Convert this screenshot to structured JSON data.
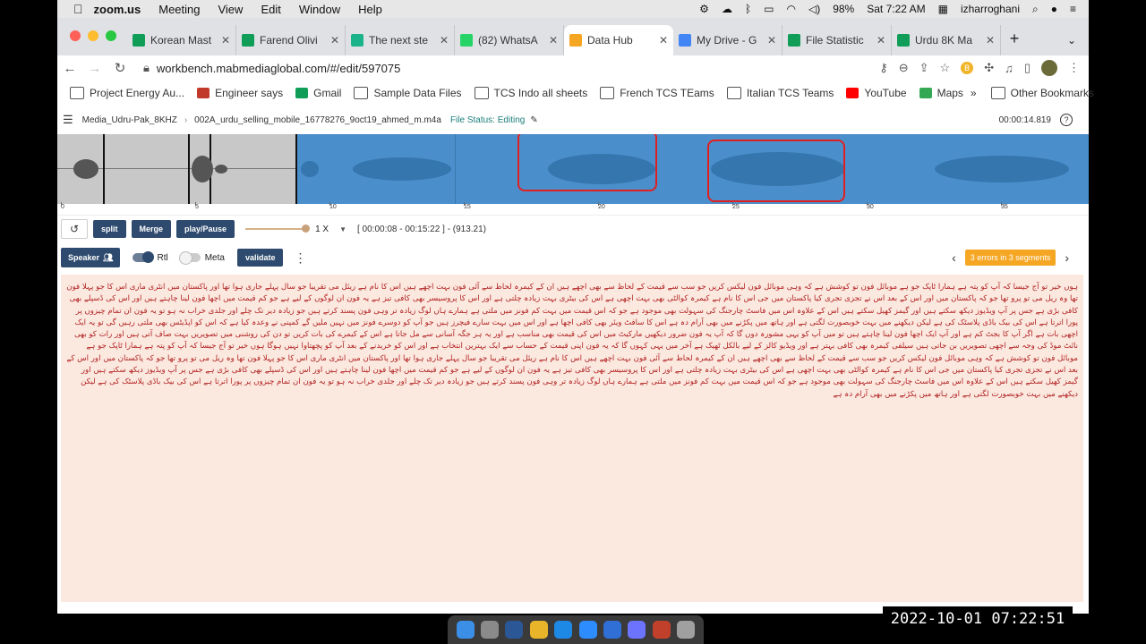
{
  "mac_menubar": {
    "app": "zoom.us",
    "menus": [
      "Meeting",
      "View",
      "Edit",
      "Window",
      "Help"
    ],
    "battery": "98%",
    "clock": "Sat 7:22 AM",
    "user": "izharroghani",
    "icons": [
      "gear-icon",
      "cloud-icon",
      "bluetooth-icon",
      "battery-icon",
      "wifi-icon",
      "volume-icon",
      "search-icon"
    ]
  },
  "tabs": [
    {
      "title": "Korean Mast",
      "color": "#0f9d58"
    },
    {
      "title": "Farend Olivi",
      "color": "#0f9d58"
    },
    {
      "title": "The next ste",
      "color": "#1bb38a"
    },
    {
      "title": "(82) WhatsA",
      "color": "#25d366"
    },
    {
      "title": "Data Hub",
      "color": "#f5a623",
      "active": true
    },
    {
      "title": "My Drive - G",
      "color": "#4285f4"
    },
    {
      "title": "File Statistic",
      "color": "#0f9d58"
    },
    {
      "title": "Urdu 8K Ma",
      "color": "#0f9d58"
    }
  ],
  "address": {
    "url": "workbench.mabmediaglobal.com/#/edit/597075"
  },
  "bookmarks": [
    {
      "label": "Project Energy Au...",
      "kind": "folder"
    },
    {
      "label": "Engineer says",
      "kind": "flag",
      "color": "#c0392b"
    },
    {
      "label": "Gmail",
      "kind": "icon",
      "color": "#0f9d58"
    },
    {
      "label": "Sample Data Files",
      "kind": "folder"
    },
    {
      "label": "TCS Indo all sheets",
      "kind": "folder"
    },
    {
      "label": "French TCS TEams",
      "kind": "folder"
    },
    {
      "label": "Italian TCS Teams",
      "kind": "folder"
    },
    {
      "label": "YouTube",
      "kind": "icon",
      "color": "#ff0000"
    },
    {
      "label": "Maps",
      "kind": "icon",
      "color": "#34a853"
    }
  ],
  "bookmarks_more": "»",
  "other_bookmarks": "Other Bookmarks",
  "breadcrumb": {
    "project": "Media_Udru-Pak_8KHZ",
    "file": "002A_urdu_selling_mobile_16778276_9oct19_ahmed_m.m4a",
    "status": "File Status: Editing",
    "time": "00:00:14.819"
  },
  "ruler": {
    "ticks": [
      "0",
      "5",
      "10",
      "15",
      "20",
      "25",
      "30",
      "35"
    ]
  },
  "controls": {
    "split": "split",
    "merge": "Merge",
    "play": "play/Pause",
    "speed": "1 X",
    "range": "[ 00:00:08 - 00:15:22 ] - (913.21)"
  },
  "toolbar2": {
    "speaker": "Speaker",
    "rtl": "Rtl",
    "meta": "Meta",
    "validate": "validate",
    "errors": "3 errors in 3 segments"
  },
  "transcript": "ہوں خیر تو آج جیسا کہ آپ کو پتہ ہے ہمارا ٹاپک جو ہے موبائل فون تو کوشش ہے کہ وہی موبائل فون لیکس کریں جو سب سے قیمت کے لحاظ سے بھی اچھے ہیں ان کے کیمرہ لحاظ سے آئی فون بہت اچھے ہیں اس کا نام ہے ریئل می تقریبا جو سال پہلے جاری ہوا تھا اور پاکستان میں انٹری ماری اس کا جو پہلا فون تھا وہ ریل می تو پرو تھا جو کہ پاکستان میں اور اس کے بعد اس نے تجزی تجری کیا پاکستان میں جی اس کا نام ہے کیمرہ کوالٹی بھی بہت اچھی ہے اس کی بیٹری بہت زیادہ چلتی ہے اور اس کا پروسیسر بھی کافی تیز ہے یہ فون ان لوگوں کے لیے ہے جو کم قیمت میں اچھا فون لینا چاہتے ہیں اور اس کی ڈسپلے بھی کافی بڑی ہے جس پر آپ ویڈیوز دیکھ سکتے ہیں اور گیمز کھیل سکتے ہیں اس کے علاوہ اس میں فاسٹ چارجنگ کی سہولت بھی موجود ہے جو کہ اس قیمت میں بہت کم فونز میں ملتی ہے ہمارے ہاں لوگ زیادہ تر وہی فون پسند کرتے ہیں جو زیادہ دیر تک چلے اور جلدی خراب نہ ہو تو یہ فون ان تمام چیزوں پر پورا اترتا ہے اس کی بیک باڈی پلاسٹک کی ہے لیکن دیکھنے میں بہت خوبصورت لگتی ہے اور ہاتھ میں پکڑنے میں بھی آرام دہ ہے اس کا سافٹ ویئر بھی کافی اچھا ہے اور اس میں بہت سارے فیچرز ہیں جو آپ کو دوسرے فونز میں نہیں ملیں گے کمپنی نے وعدہ کیا ہے کہ اس کو اپڈیٹس بھی ملتی رہیں گی تو یہ ایک اچھی بات ہے اگر آپ کا بجٹ کم ہے اور آپ ایک اچھا فون لینا چاہتے ہیں تو میں آپ کو یہی مشورہ دوں گا کہ آپ یہ فون ضرور دیکھیں مارکیٹ میں اس کی قیمت بھی مناسب ہے اور یہ ہر جگہ آسانی سے مل جاتا ہے اس کے کیمرے کی بات کریں تو دن کی روشنی میں تصویریں بہت صاف آتی ہیں اور رات کو بھی نائٹ موڈ کی وجہ سے اچھی تصویریں بن جاتی ہیں سیلفی کیمرہ بھی کافی بہتر ہے اور ویڈیو کالز کے لیے بالکل ٹھیک ہے آخر میں یہی کہوں گا کہ یہ فون اپنی قیمت کے حساب سے ایک بہترین انتخاب ہے اور اس کو خریدنے کے بعد آپ کو پچھتاوا نہیں ہوگا ہوں خیر تو آج جیسا کہ آپ کو پتہ ہے ہمارا ٹاپک جو ہے موبائل فون تو کوشش ہے کہ وہی موبائل فون لیکس کریں جو سب سے قیمت کے لحاظ سے بھی اچھے ہیں ان کے کیمرہ لحاظ سے آئی فون بہت اچھے ہیں اس کا نام ہے ریئل می تقریبا جو سال پہلے جاری ہوا تھا اور پاکستان میں انٹری ماری اس کا جو پہلا فون تھا وہ ریل می تو پرو تھا جو کہ پاکستان میں اور اس کے بعد اس نے تجزی تجری کیا پاکستان میں جی اس کا نام ہے کیمرہ کوالٹی بھی بہت اچھی ہے اس کی بیٹری بہت زیادہ چلتی ہے اور اس کا پروسیسر بھی کافی تیز ہے یہ فون ان لوگوں کے لیے ہے جو کم قیمت میں اچھا فون لینا چاہتے ہیں اور اس کی ڈسپلے بھی کافی بڑی ہے جس پر آپ ویڈیوز دیکھ سکتے ہیں اور گیمز کھیل سکتے ہیں اس کے علاوہ اس میں فاسٹ چارجنگ کی سہولت بھی موجود ہے جو کہ اس قیمت میں بہت کم فونز میں ملتی ہے ہمارے ہاں لوگ زیادہ تر وہی فون پسند کرتے ہیں جو زیادہ دیر تک چلے اور جلدی خراب نہ ہو تو یہ فون ان تمام چیزوں پر پورا اترتا ہے اس کی بیک باڈی پلاسٹک کی ہے لیکن دیکھنے میں بہت خوبصورت لگتی ہے اور ہاتھ میں پکڑنے میں بھی آرام دہ ہے",
  "timestamp_overlay": "2022-10-01 07:22:51",
  "colors": {
    "accent": "#2e4a6e",
    "error": "#f5a623",
    "waveform": "#4a8fcc",
    "text": "#b22222"
  }
}
